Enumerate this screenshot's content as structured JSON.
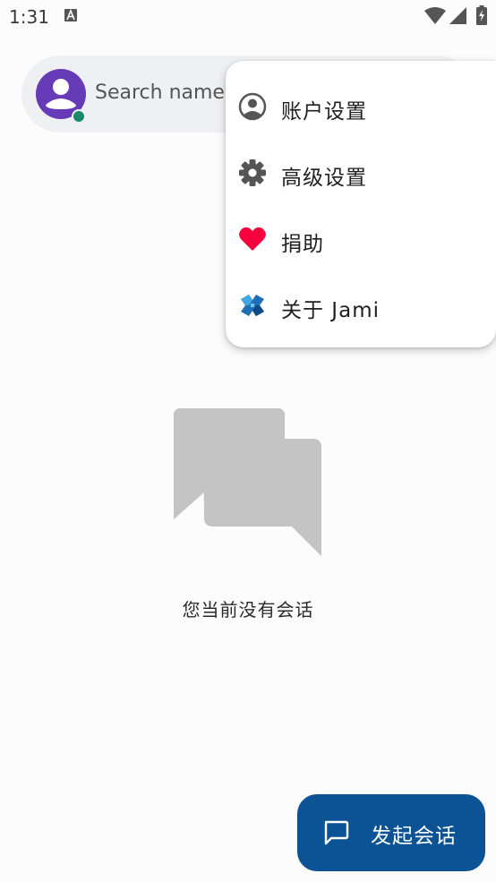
{
  "status_bar": {
    "time": "1:31"
  },
  "search": {
    "placeholder": "Search name"
  },
  "menu": {
    "items": [
      {
        "label": "账户设置",
        "icon": "account-circle-icon"
      },
      {
        "label": "高级设置",
        "icon": "gear-icon"
      },
      {
        "label": "捐助",
        "icon": "heart-icon"
      },
      {
        "label": "关于 Jami",
        "icon": "jami-logo-icon"
      }
    ]
  },
  "empty_state": {
    "message": "您当前没有会话"
  },
  "fab": {
    "label": "发起会话",
    "icon": "chat-bubble-icon"
  },
  "colors": {
    "avatar_bg": "#673ab7",
    "presence_online": "#198a6a",
    "heart": "#f5003c",
    "fab_bg": "#0b5394",
    "illustration": "#c4c4c4"
  }
}
